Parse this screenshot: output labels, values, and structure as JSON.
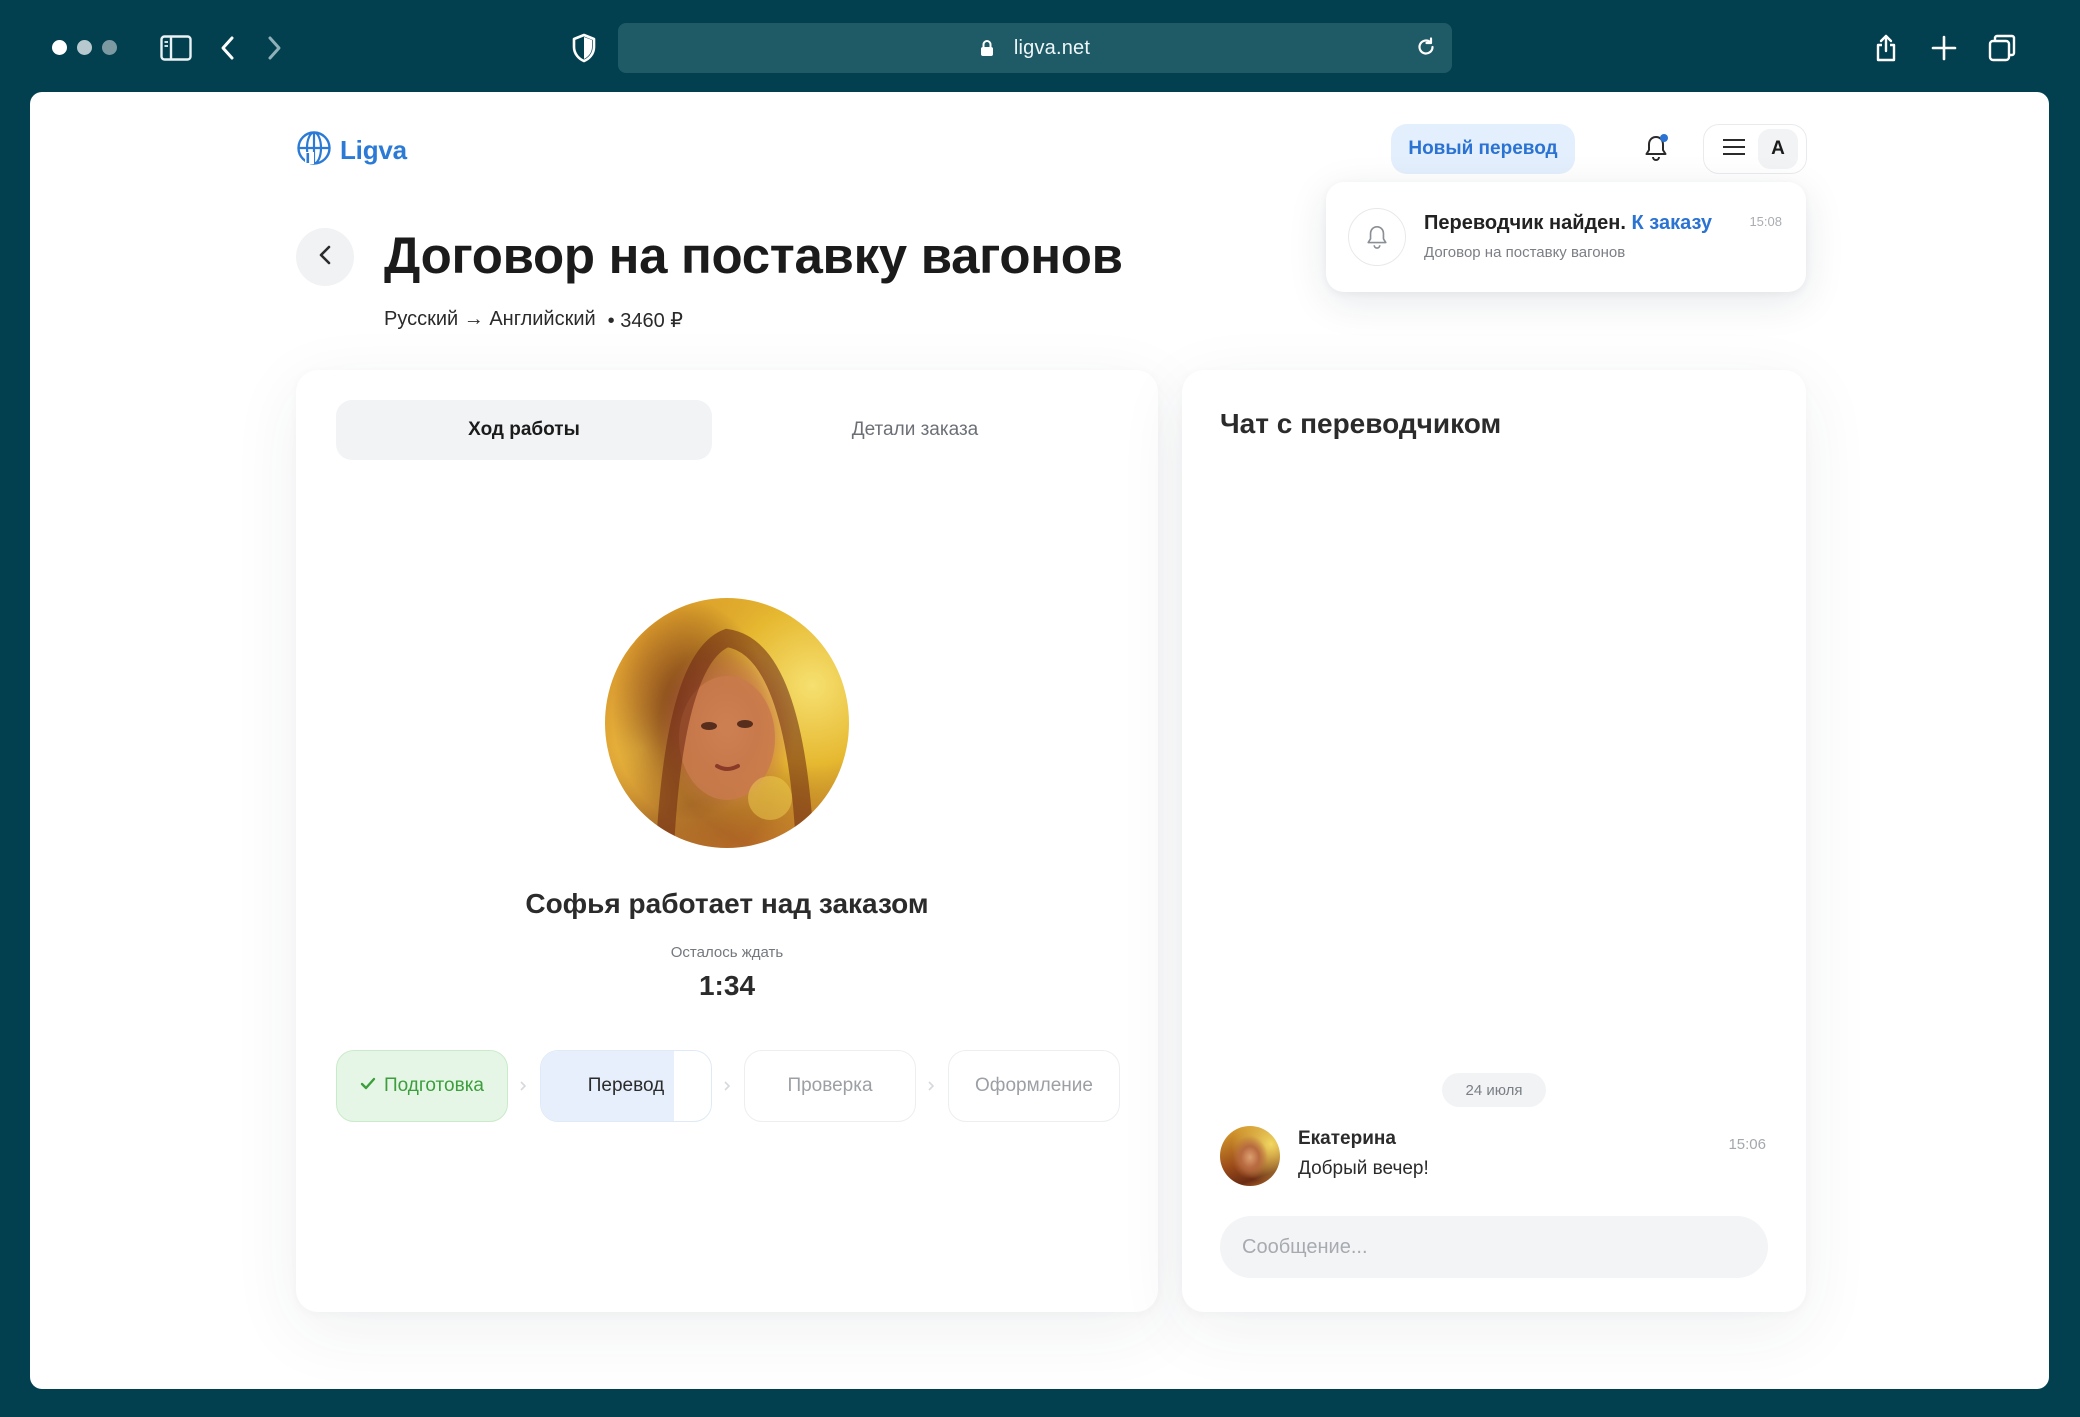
{
  "browser": {
    "url": "ligva.net"
  },
  "header": {
    "logo_text": "Ligva",
    "new_translation_button": "Новый перевод",
    "avatar_letter": "A"
  },
  "notification": {
    "title": "Переводчик найден.",
    "link": "К заказу",
    "subtitle": "Договор на поставку вагонов",
    "time": "15:08"
  },
  "order": {
    "title": "Договор на поставку вагонов",
    "languages": "Русский → Английский",
    "price": "• 3460 ₽"
  },
  "tabs": {
    "progress": "Ход работы",
    "details": "Детали заказа"
  },
  "progress": {
    "worker_status": "Софья работает над заказом",
    "wait_label": "Осталось ждать",
    "timer": "1:34",
    "steps": [
      {
        "label": "Подготовка",
        "state": "done"
      },
      {
        "label": "Перевод",
        "state": "active",
        "progress": 0.78
      },
      {
        "label": "Проверка",
        "state": "pending"
      },
      {
        "label": "Оформление",
        "state": "pending"
      }
    ]
  },
  "chat": {
    "title": "Чат с переводчиком",
    "date": "24 июля",
    "messages": [
      {
        "author": "Екатерина",
        "text": "Добрый вечер!",
        "time": "15:06"
      }
    ],
    "input_placeholder": "Сообщение..."
  },
  "colors": {
    "chrome_bg": "#02404f",
    "accent": "#2b73d3",
    "accent_bg": "#e3effd",
    "done_green": "#3c9e3c",
    "done_bg": "#e6f6e6"
  }
}
